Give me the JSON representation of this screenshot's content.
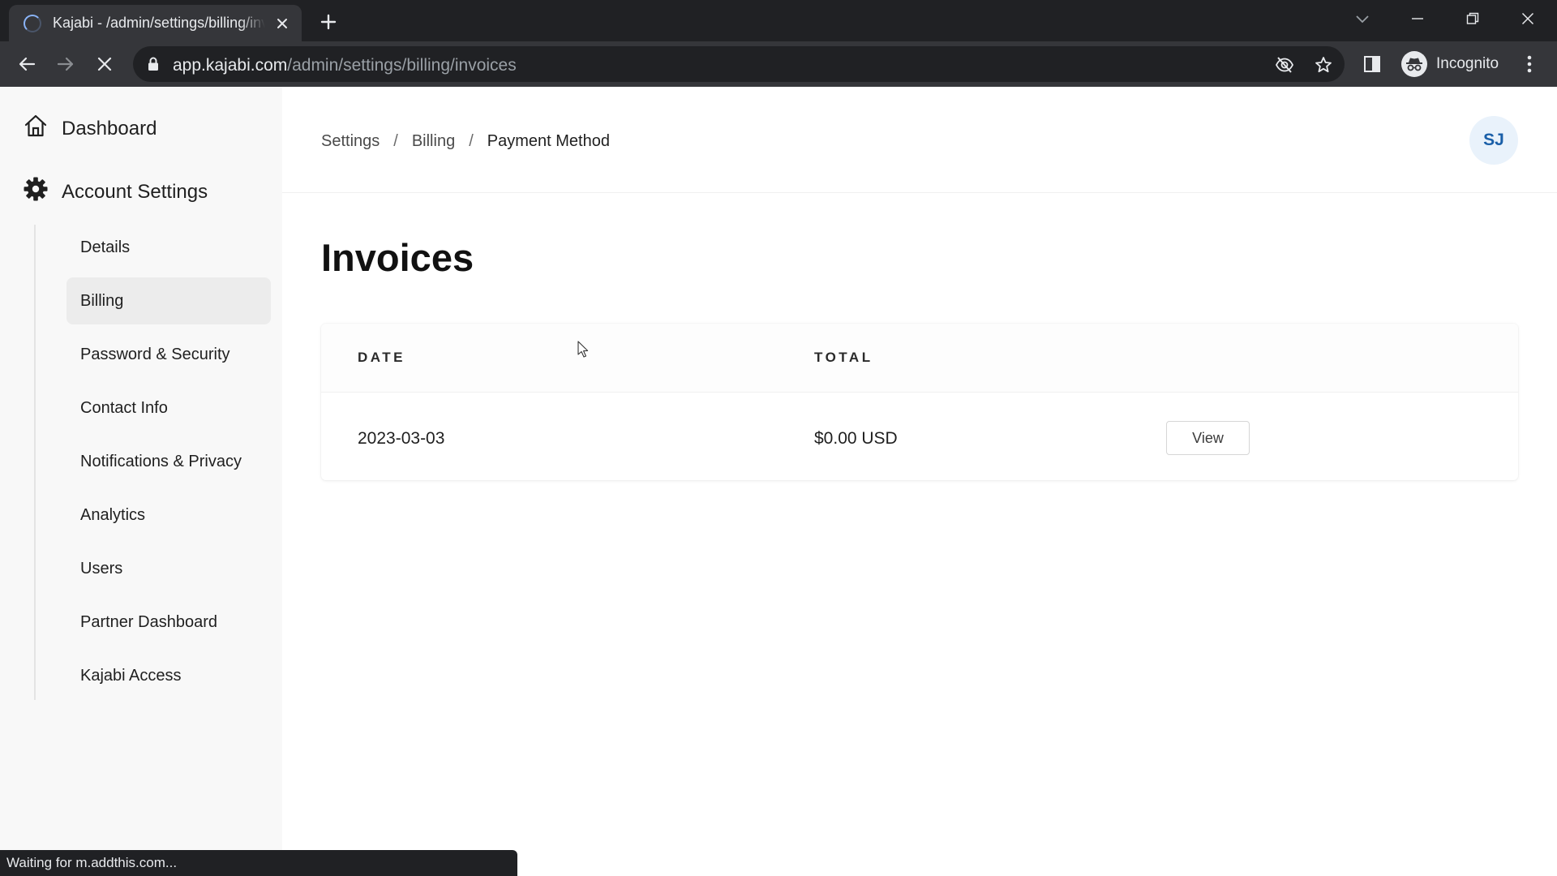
{
  "browser": {
    "tab_title": "Kajabi - /admin/settings/billing/invoices",
    "url_host": "app.kajabi.com",
    "url_path": "/admin/settings/billing/invoices",
    "profile_label": "Incognito",
    "status_text": "Waiting for m.addthis.com..."
  },
  "sidebar": {
    "dashboard_label": "Dashboard",
    "account_settings_label": "Account Settings",
    "items": [
      {
        "label": "Details"
      },
      {
        "label": "Billing",
        "active": true
      },
      {
        "label": "Password & Security"
      },
      {
        "label": "Contact Info"
      },
      {
        "label": "Notifications & Privacy"
      },
      {
        "label": "Analytics"
      },
      {
        "label": "Users"
      },
      {
        "label": "Partner Dashboard"
      },
      {
        "label": "Kajabi Access"
      }
    ]
  },
  "header": {
    "breadcrumb": [
      "Settings",
      "Billing",
      "Payment Method"
    ],
    "avatar_initials": "SJ"
  },
  "main": {
    "title": "Invoices",
    "table": {
      "columns": [
        "DATE",
        "TOTAL"
      ],
      "rows": [
        {
          "date": "2023-03-03",
          "total": "$0.00 USD",
          "action": "View"
        }
      ]
    }
  },
  "colors": {
    "active_item_bg": "#ececec",
    "avatar_bg": "#e9f2fb",
    "avatar_text": "#1a5fa8"
  }
}
